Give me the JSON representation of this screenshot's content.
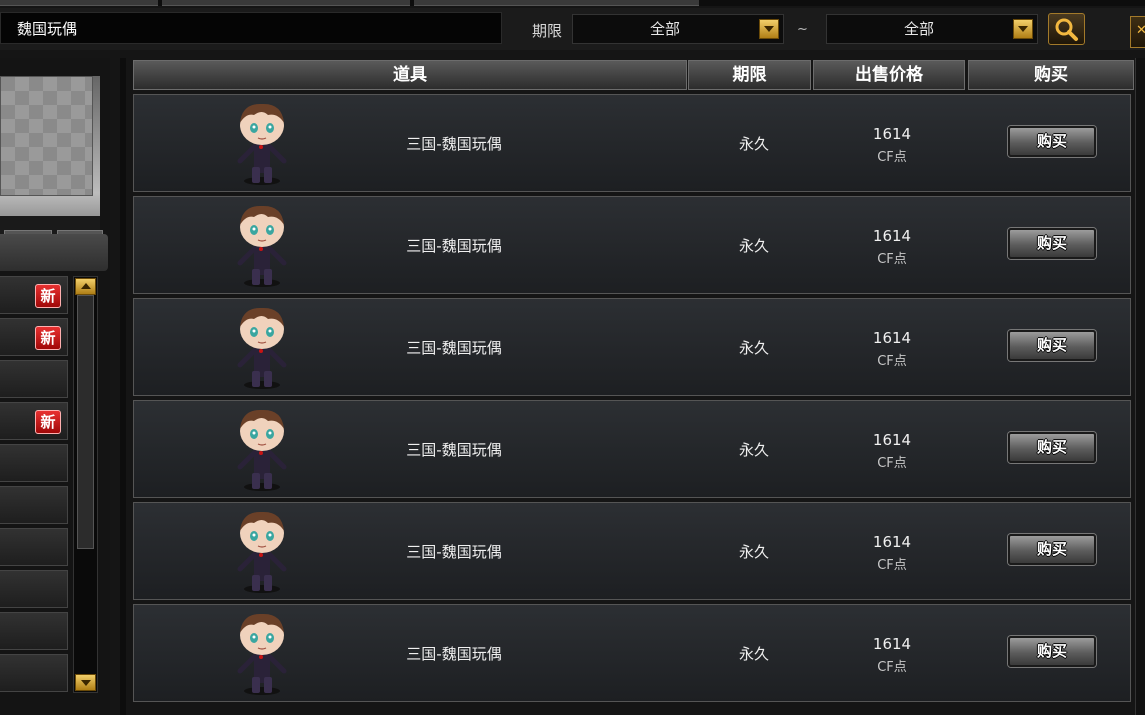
{
  "search": {
    "query": "魏国玩偶",
    "period_label": "期限",
    "period_from": "全部",
    "range_separator": "~",
    "period_to": "全部"
  },
  "categories": {
    "items": [
      {
        "new_badge": "新"
      },
      {
        "new_badge": "新"
      },
      {
        "new_badge": ""
      },
      {
        "new_badge": "新"
      },
      {
        "new_badge": ""
      },
      {
        "new_badge": ""
      },
      {
        "new_badge": ""
      },
      {
        "new_badge": ""
      },
      {
        "new_badge": ""
      },
      {
        "new_badge": ""
      }
    ]
  },
  "table": {
    "headers": {
      "item": "道具",
      "period": "期限",
      "price": "出售价格",
      "buy": "购买"
    },
    "rows": [
      {
        "name": "三国-魏国玩偶",
        "period": "永久",
        "price": "1614",
        "currency": "CF点",
        "buy_label": "购买"
      },
      {
        "name": "三国-魏国玩偶",
        "period": "永久",
        "price": "1614",
        "currency": "CF点",
        "buy_label": "购买"
      },
      {
        "name": "三国-魏国玩偶",
        "period": "永久",
        "price": "1614",
        "currency": "CF点",
        "buy_label": "购买"
      },
      {
        "name": "三国-魏国玩偶",
        "period": "永久",
        "price": "1614",
        "currency": "CF点",
        "buy_label": "购买"
      },
      {
        "name": "三国-魏国玩偶",
        "period": "永久",
        "price": "1614",
        "currency": "CF点",
        "buy_label": "购买"
      },
      {
        "name": "三国-魏国玩偶",
        "period": "永久",
        "price": "1614",
        "currency": "CF点",
        "buy_label": "购买"
      }
    ]
  },
  "icons": {
    "search": "magnifier-icon",
    "close": "close-icon",
    "dropdown": "chevron-down-icon",
    "new": "new-badge",
    "avatar": "doll-avatar"
  },
  "colors": {
    "accent_gold": "#c9952a",
    "badge_red": "#c81414",
    "row_bg": "#26292d"
  }
}
